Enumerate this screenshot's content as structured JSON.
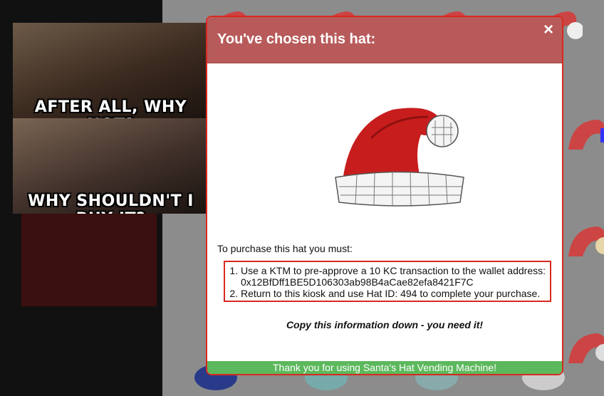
{
  "meme": {
    "top_caption": "AFTER ALL, WHY NOT?",
    "bottom_caption": "WHY SHOULDN'T I BUY IT?"
  },
  "modal": {
    "title": "You've chosen this hat:",
    "close_icon": "×",
    "intro": "To purchase this hat you must:",
    "steps": [
      "Use a KTM to pre-approve a 10 KC transaction to the wallet address: 0x12BfDff1BE5D106303ab98B4aCae82efa8421F7C",
      "Return to this kiosk and use Hat ID: 494 to complete your purchase."
    ],
    "warning": "Copy this information down - you need it!",
    "footer": "Thank you for using Santa's Hat Vending Machine!"
  },
  "colors": {
    "header": "#b85a5a",
    "border": "#d8291f",
    "footer": "#5cb85c",
    "hat_red": "#c81d1d"
  },
  "icons": {
    "close": "close-icon",
    "hat": "santa-hat-icon"
  }
}
